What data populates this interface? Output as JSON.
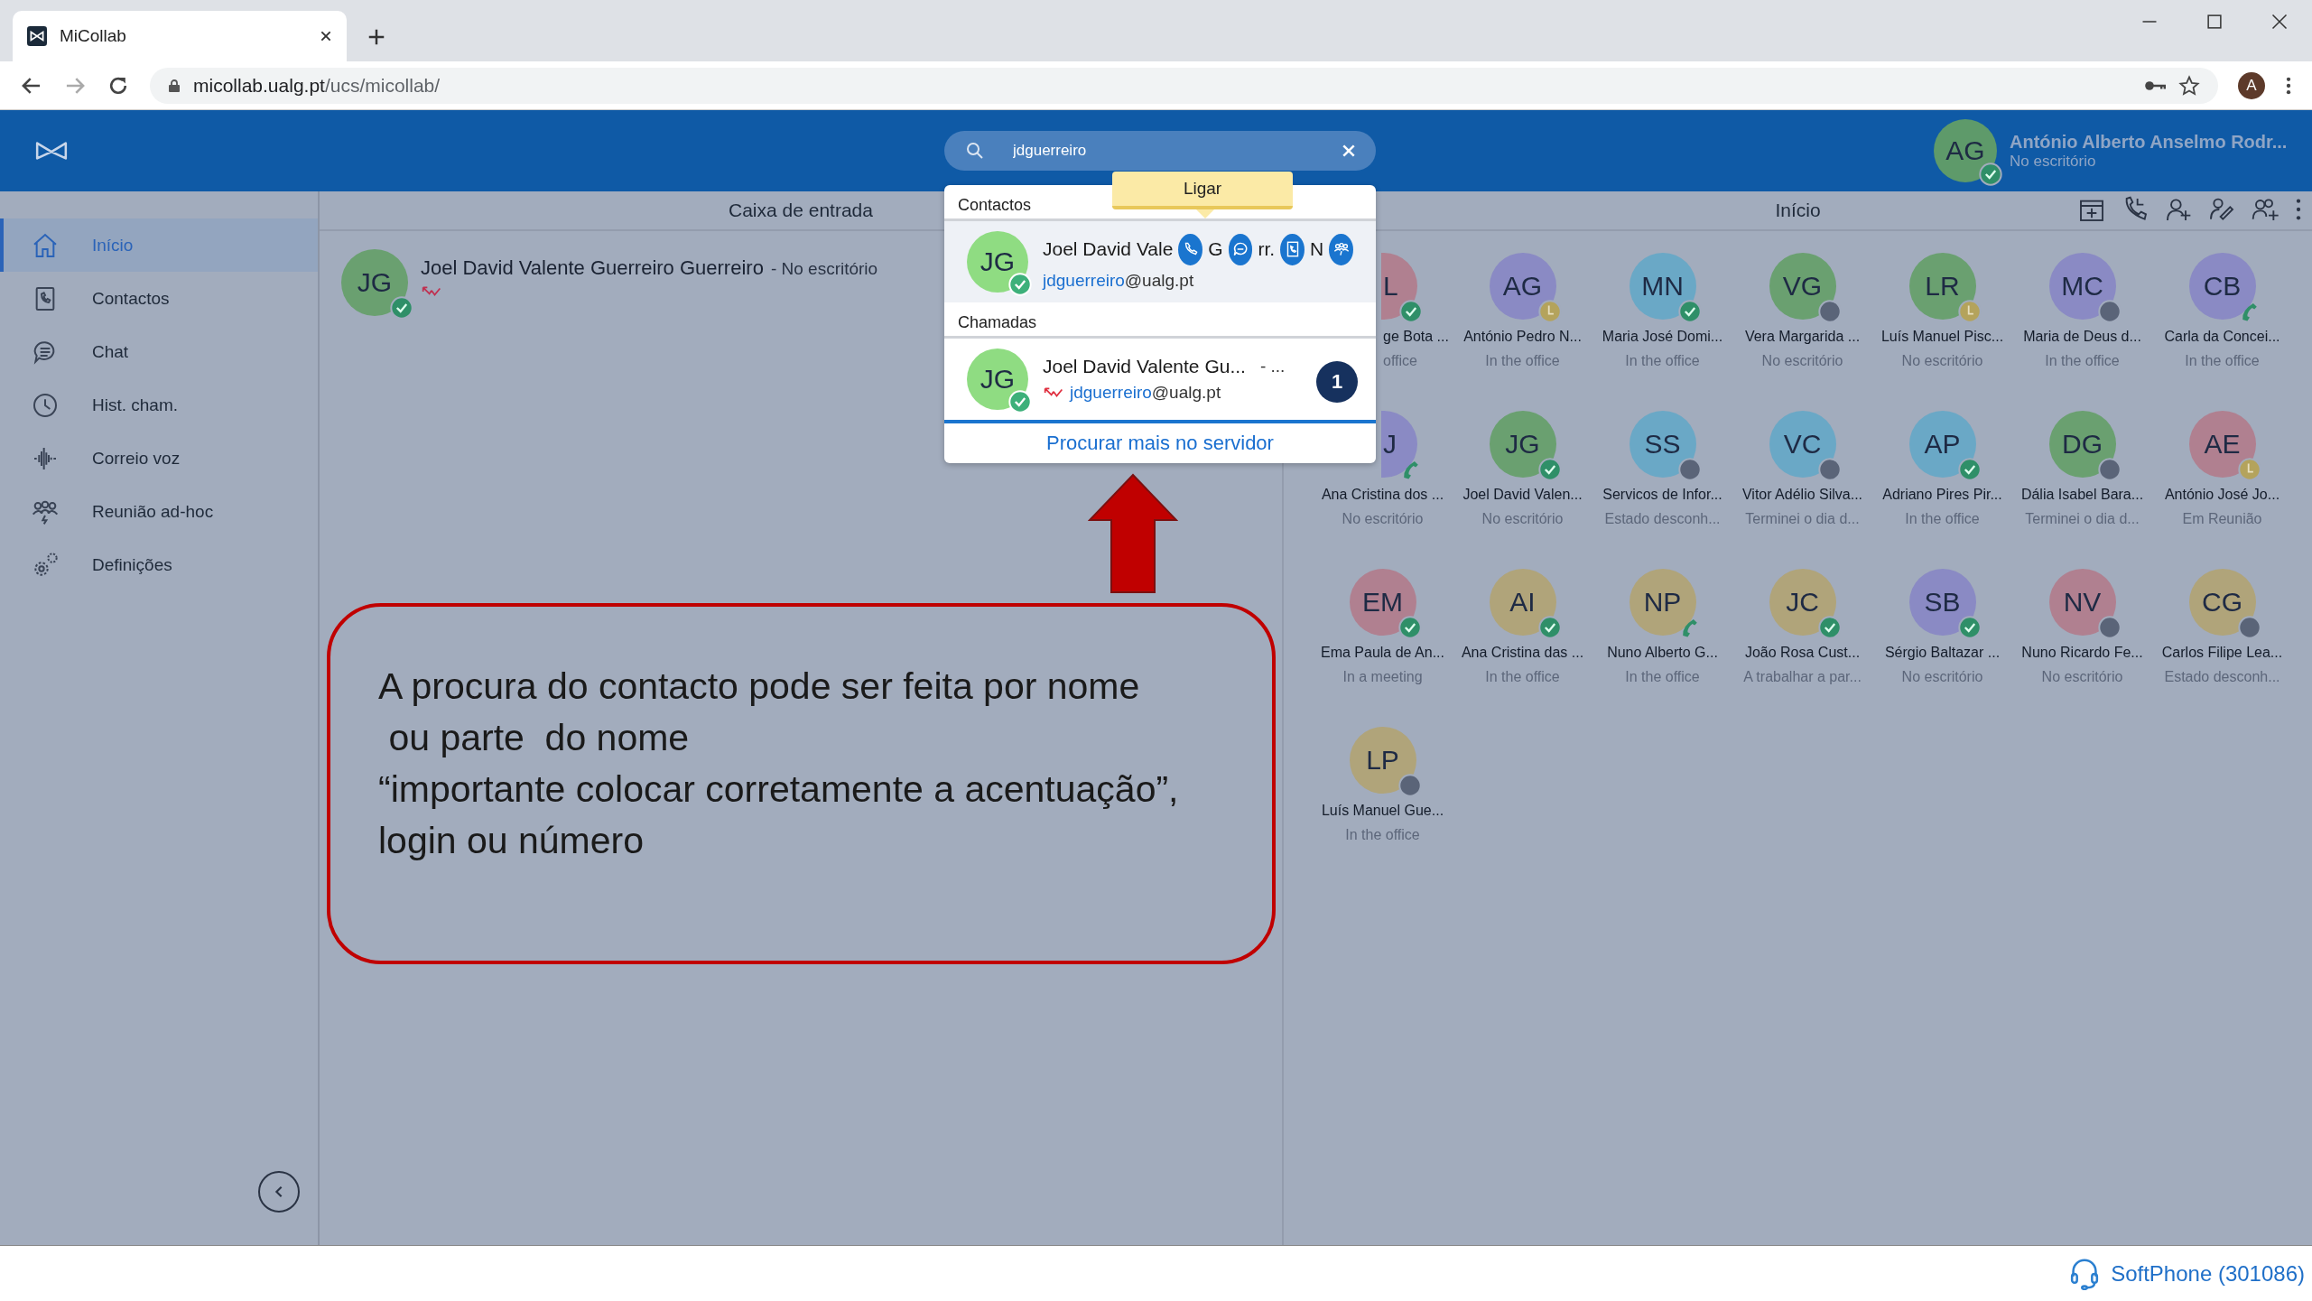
{
  "browser": {
    "tab_title": "MiCollab",
    "url_host": "micollab.ualg.pt",
    "url_path": "/ucs/micollab/",
    "profile_initial": "A"
  },
  "header": {
    "search_value": "jdguerreiro",
    "user": {
      "initials": "AG",
      "name": "António Alberto Anselmo Rodr...",
      "status": "No escritório",
      "badge": {
        "kind": "ok"
      }
    }
  },
  "sidebar": {
    "items": [
      {
        "label": "Início",
        "kind": "home",
        "selected": true
      },
      {
        "label": "Contactos",
        "kind": "contacts",
        "selected": false
      },
      {
        "label": "Chat",
        "kind": "chat",
        "selected": false
      },
      {
        "label": "Hist. cham.",
        "kind": "history",
        "selected": false
      },
      {
        "label": "Correio voz",
        "kind": "voicemail",
        "selected": false
      },
      {
        "label": "Reunião ad-hoc",
        "kind": "meeting",
        "selected": false
      },
      {
        "label": "Definições",
        "kind": "settings",
        "selected": false
      }
    ]
  },
  "inbox": {
    "title": "Caixa de entrada",
    "items": [
      {
        "initials": "JG",
        "color": "#6aa070",
        "badge": {
          "kind": "ok"
        },
        "name": "Joel David Valente Guerreiro Guerreiro",
        "status": "- No escritório"
      }
    ]
  },
  "search_results": {
    "tooltip": "Ligar",
    "contacts_heading": "Contactos",
    "contact": {
      "initials": "JG",
      "name": "Joel David Vale",
      "email_match": "jdguerreiro",
      "email_rest": "@ualg.pt",
      "actions": [
        {
          "kind": "call",
          "after": "G"
        },
        {
          "kind": "chat",
          "after": "rr."
        },
        {
          "kind": "card",
          "after": "N"
        },
        {
          "kind": "meeting"
        }
      ]
    },
    "calls_heading": "Chamadas",
    "call": {
      "initials": "JG",
      "name": "Joel David Valente Gu...",
      "suffix": "- ...",
      "email_match": "jdguerreiro",
      "email_rest": "@ualg.pt",
      "count": "1"
    },
    "more_link": "Procurar mais no servidor"
  },
  "home": {
    "title": "Início",
    "contacts": [
      {
        "initials": "L",
        "name": "ge Bota ...",
        "status": "office",
        "badge": {
          "kind": "ok"
        },
        "color": "#b08090",
        "kind": "cut"
      },
      {
        "initials": "AG",
        "name": "António Pedro N...",
        "status": "In the office",
        "badge": {
          "kind": "away"
        },
        "color": "#8a8ac4",
        "kind": "full"
      },
      {
        "initials": "MN",
        "name": "Maria José Domi...",
        "status": "In the office",
        "badge": {
          "kind": "ok"
        },
        "color": "#6aa8c6",
        "kind": "full"
      },
      {
        "initials": "VG",
        "name": "Vera Margarida ...",
        "status": "No escritório",
        "badge": {
          "kind": "offline"
        },
        "color": "#6aa070",
        "kind": "full"
      },
      {
        "initials": "LR",
        "name": "Luís Manuel Pisc...",
        "status": "No escritório",
        "badge": {
          "kind": "away"
        },
        "color": "#6aa070",
        "kind": "full"
      },
      {
        "initials": "MC",
        "name": "Maria de Deus d...",
        "status": "In the office",
        "badge": {
          "kind": "offline"
        },
        "color": "#8a8ac4",
        "kind": "full"
      },
      {
        "initials": "CB",
        "name": "Carla da Concei...",
        "status": "In the office",
        "badge": {
          "kind": "call"
        },
        "color": "#8a8ac4",
        "kind": "full"
      },
      {
        "initials": "J",
        "name": "Ana Cristina dos ...",
        "status": "No escritório",
        "badge": {
          "kind": "call"
        },
        "color": "#8a8ac4",
        "kind": "cut-avatar"
      },
      {
        "initials": "JG",
        "name": "Joel David Valen...",
        "status": "No escritório",
        "badge": {
          "kind": "ok"
        },
        "color": "#6aa070",
        "kind": "full"
      },
      {
        "initials": "SS",
        "name": "Servicos de Infor...",
        "status": "Estado desconh...",
        "badge": {
          "kind": "offline"
        },
        "color": "#6aa8c6",
        "kind": "full"
      },
      {
        "initials": "VC",
        "name": "Vitor Adélio Silva...",
        "status": "Terminei o dia d...",
        "badge": {
          "kind": "offline"
        },
        "color": "#6aa8c6",
        "kind": "full"
      },
      {
        "initials": "AP",
        "name": "Adriano Pires Pir...",
        "status": "In the office",
        "badge": {
          "kind": "ok"
        },
        "color": "#6aa8c6",
        "kind": "full"
      },
      {
        "initials": "DG",
        "name": "Dália Isabel Bara...",
        "status": "Terminei o dia d...",
        "badge": {
          "kind": "offline"
        },
        "color": "#6aa070",
        "kind": "full"
      },
      {
        "initials": "AE",
        "name": "António José Jo...",
        "status": "Em Reunião",
        "badge": {
          "kind": "away"
        },
        "color": "#b08090",
        "kind": "full"
      },
      {
        "initials": "EM",
        "name": "Ema Paula de An...",
        "status": "In a meeting",
        "badge": {
          "kind": "ok"
        },
        "color": "#b08090",
        "kind": "full"
      },
      {
        "initials": "AI",
        "name": "Ana Cristina das ...",
        "status": "In the office",
        "badge": {
          "kind": "ok"
        },
        "color": "#b0a47a",
        "kind": "full"
      },
      {
        "initials": "NP",
        "name": "Nuno Alberto G...",
        "status": "In the office",
        "badge": {
          "kind": "call"
        },
        "color": "#b0a47a",
        "kind": "full"
      },
      {
        "initials": "JC",
        "name": "João Rosa Cust...",
        "status": "A trabalhar a par...",
        "badge": {
          "kind": "ok"
        },
        "color": "#b0a47a",
        "kind": "full"
      },
      {
        "initials": "SB",
        "name": "Sérgio Baltazar ...",
        "status": "No escritório",
        "badge": {
          "kind": "ok"
        },
        "color": "#8a8ac4",
        "kind": "full"
      },
      {
        "initials": "NV",
        "name": "Nuno Ricardo Fe...",
        "status": "No escritório",
        "badge": {
          "kind": "offline"
        },
        "color": "#b08090",
        "kind": "full"
      },
      {
        "initials": "CG",
        "name": "Carlos Filipe Lea...",
        "status": "Estado desconh...",
        "badge": {
          "kind": "offline"
        },
        "color": "#b0a47a",
        "kind": "full"
      },
      {
        "initials": "LP",
        "name": "Luís Manuel Gue...",
        "status": "In the office",
        "badge": {
          "kind": "offline"
        },
        "color": "#b0a47a",
        "kind": "full"
      }
    ]
  },
  "callout": {
    "lines": [
      "A procura do contacto pode ser feita por nome",
      " ou parte  do nome",
      "“importante colocar corretamente a acentuação”,",
      "login ou número"
    ]
  },
  "status_bar": {
    "softphone": "SoftPhone (301086)"
  }
}
